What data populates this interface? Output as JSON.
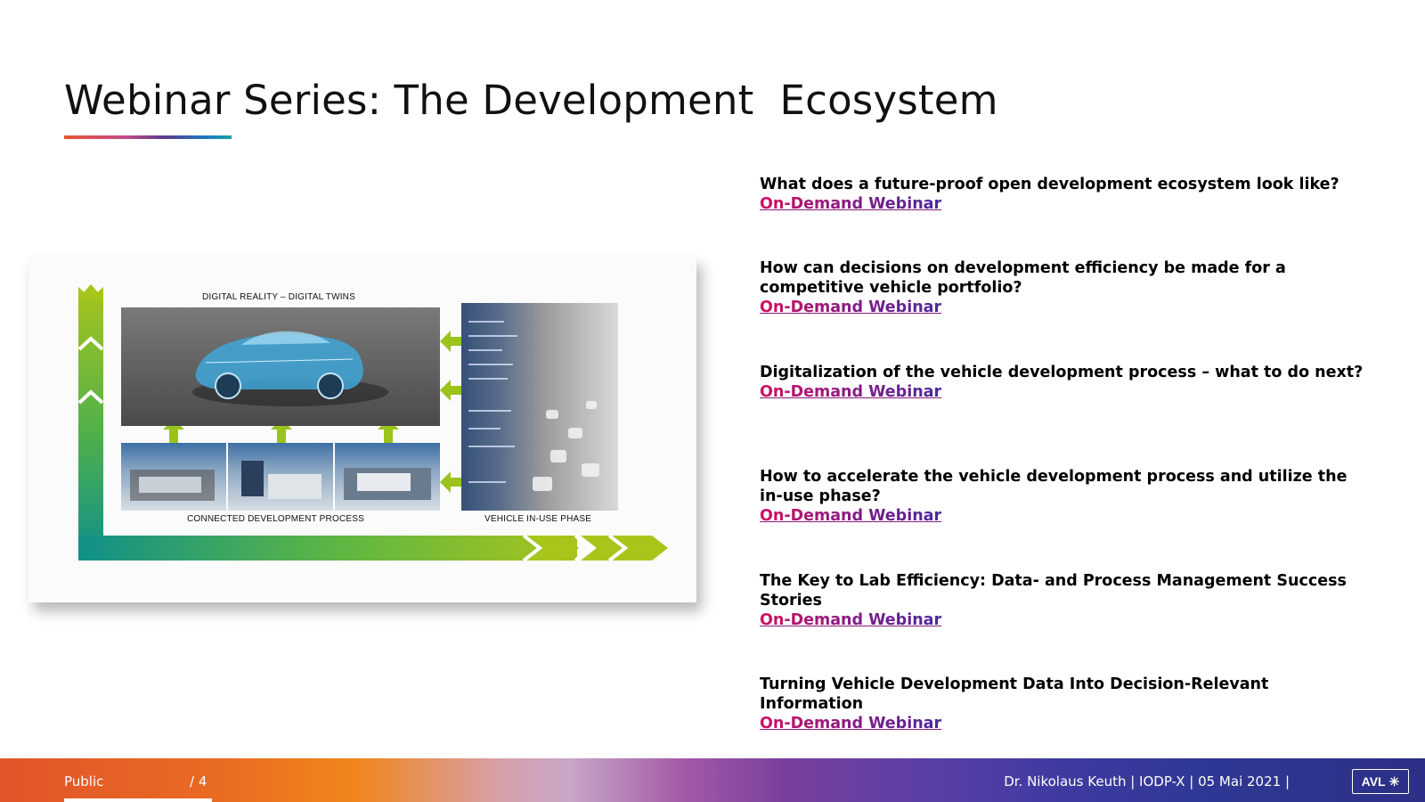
{
  "slide": {
    "title": "Webinar Series: The Development  Ecosystem"
  },
  "figure": {
    "label_top": "DIGITAL REALITY – DIGITAL TWINS",
    "label_bottom_left": "CONNECTED DEVELOPMENT PROCESS",
    "label_bottom_right": "VEHICLE IN-USE PHASE",
    "colors": {
      "arrow_green": "#9ac31c",
      "arrow_teal": "#0f8e86"
    }
  },
  "webinars": [
    {
      "question": "What does a future-proof open development ecosystem look  like?",
      "link": "On-Demand  Webinar"
    },
    {
      "question": "How can decisions on development efficiency be made for  a competitive vehicle  portfolio?",
      "link": "On-Demand  Webinar"
    },
    {
      "question": "Digitalization of the vehicle development process – what to  do next?",
      "link": "On-Demand  Webinar"
    },
    {
      "question": "How to accelerate the vehicle development process and utilize the in-use  phase?",
      "link": "On-Demand  Webinar"
    },
    {
      "question": "The Key to Lab Efficiency: Data- and Process Management Success  Stories",
      "link": "On-Demand  Webinar"
    },
    {
      "question": "Turning Vehicle Development Data Into Decision-Relevant Information",
      "link": "On-Demand  Webinar"
    }
  ],
  "footer": {
    "classification": "Public",
    "page": "/ 4",
    "author_event_date": "Dr. Nikolaus Keuth | IODP-X | 05 Mai 2021 |",
    "logo_text": "AVL"
  }
}
